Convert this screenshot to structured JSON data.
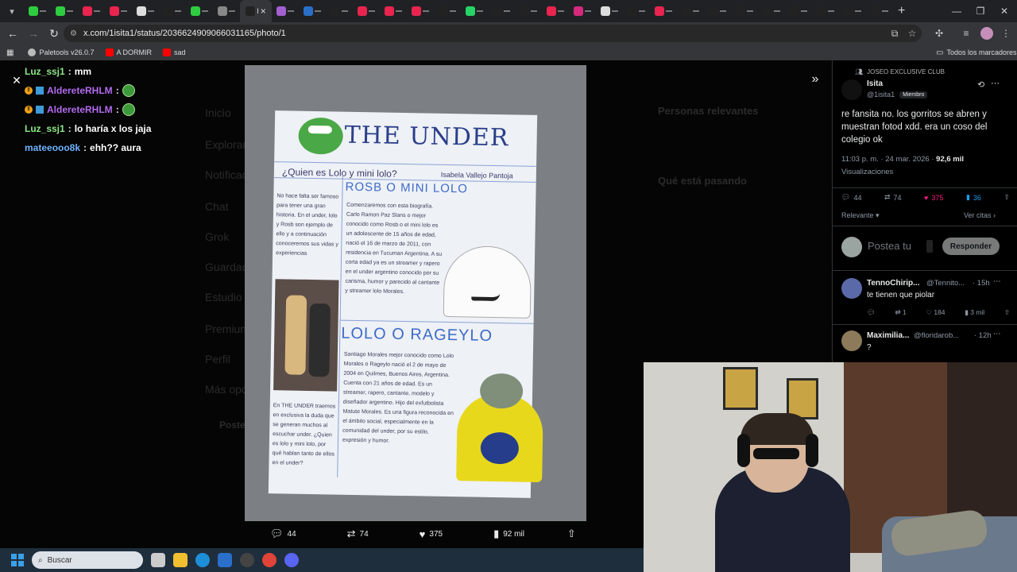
{
  "browser": {
    "active_tab_label": "I",
    "url": "x.com/1isita1/status/2036624909066031165/photo/1",
    "bookmarks": [
      {
        "label": "Paletools v26.0.7"
      },
      {
        "label": "A DORMIR"
      },
      {
        "label": "sad"
      }
    ],
    "all_bookmarks": "Todos los marcadores",
    "colors": {
      "tabstrip": "#202124",
      "toolbar": "#35363a"
    }
  },
  "chat": [
    {
      "user": "Luz_ssj1",
      "message": "mm",
      "color": "#8fe88a",
      "badges": false,
      "emote": false
    },
    {
      "user": "AldereteRHLM",
      "message": "",
      "color": "#b46cf0",
      "badges": true,
      "emote": true
    },
    {
      "user": "AldereteRHLM",
      "message": "",
      "color": "#b46cf0",
      "badges": true,
      "emote": true
    },
    {
      "user": "Luz_ssj1",
      "message": "lo haría x los jaja",
      "color": "#8fe88a",
      "badges": false,
      "emote": false
    },
    {
      "user": "mateeooo8k",
      "message": "ehh?? aura",
      "color": "#6fb4ff",
      "badges": false,
      "emote": false
    }
  ],
  "page_behind": {
    "nav": [
      "Inicio",
      "Explorar",
      "Notificaciones",
      "Chat",
      "Grok",
      "Guardados",
      "Estudio",
      "Premium",
      "Perfil",
      "Más opciones"
    ],
    "post_button": "Postear",
    "relevant_people": "Personas relevantes",
    "whats_happening": "Qué está pasando"
  },
  "photo": {
    "title": "THE UNDER",
    "question": "¿Quien es Lolo y mini lolo?",
    "author": "Isabela Vallejo Pantoja",
    "heading1": "ROSB O MINI LOLO",
    "heading2": "LOLO O RAGEYLO",
    "intro_text": "No hace falta ser famoso para tener una gran historia. En el under, lolo y Rosb son ejemplo de ello y a continuación conoceremos sus vidas y experiencias",
    "section1_text": "Comenzaremos con esta biografía. Carlo Ramon Paz Slans o mejor conocido como Rosb o el mini lolo es un adolescente de 15 años de edad, nació el 16 de marzo de 2011, con residencia en Tucuman Argentina. A su corta edad ya es un streamer y rapero en el under argentino conocido por su carisma, humor y parecido al cantante y streamer lolo Morales.",
    "section2_text": "Santiago Morales mejor conocido como Lolo Morales o Rageylo nació el 2 de mayo de 2004 en Quilmes, Buenos Aires, Argentina. Cuenta con 21 años de edad. Es un streamer, rapero, cantante, modelo y diseñador argentino. Hijo del exfutbolista Matute Morales. Es una figura reconocida en el ámbito social, especialmente en la comunidad del under, por su estilo, expresión y humor.",
    "closing_text": "En THE UNDER traemos en exclusiva la duda que se generan muchos al escuchar under. ¿Quien es lolo y mini lolo, por qué hablan tanto de ellos en el under?"
  },
  "media_actions": {
    "replies": "44",
    "reposts": "74",
    "likes": "375",
    "views": "92 mil"
  },
  "post": {
    "community": "JOSEO EXCLUSIVE CLUB",
    "name": "Isita",
    "handle": "@1isita1",
    "member_badge": "Miembro",
    "text": "re fansita no. los gorritos se abren y muestran fotod xdd. era un coso del colegio ok",
    "timestamp": "11:03 p. m. · 24 mar. 2026 · ",
    "views_count": "92,6 mil",
    "views_label": "Visualizaciones",
    "replies": "44",
    "reposts": "74",
    "likes": "375",
    "bookmarks": "36",
    "sort_label": "Relevante",
    "quotes_label": "Ver citas",
    "reply_placeholder": "Postea tu",
    "reply_button": "Responder",
    "like_color": "#f91880",
    "bookmark_color": "#1d9bf0"
  },
  "comments": [
    {
      "name": "TennoChirip...",
      "handle": "@Tennito...",
      "time": "· 15h",
      "text": "te tienen que piolar",
      "replies": "",
      "reposts": "1",
      "likes": "184",
      "views": "3 mil"
    },
    {
      "name": "Maximilia...",
      "handle": "@floridarob...",
      "time": "· 12h",
      "text": "?",
      "replies": "",
      "reposts": "",
      "likes": "",
      "views": ""
    }
  ],
  "taskbar": {
    "search_placeholder": "Buscar"
  }
}
